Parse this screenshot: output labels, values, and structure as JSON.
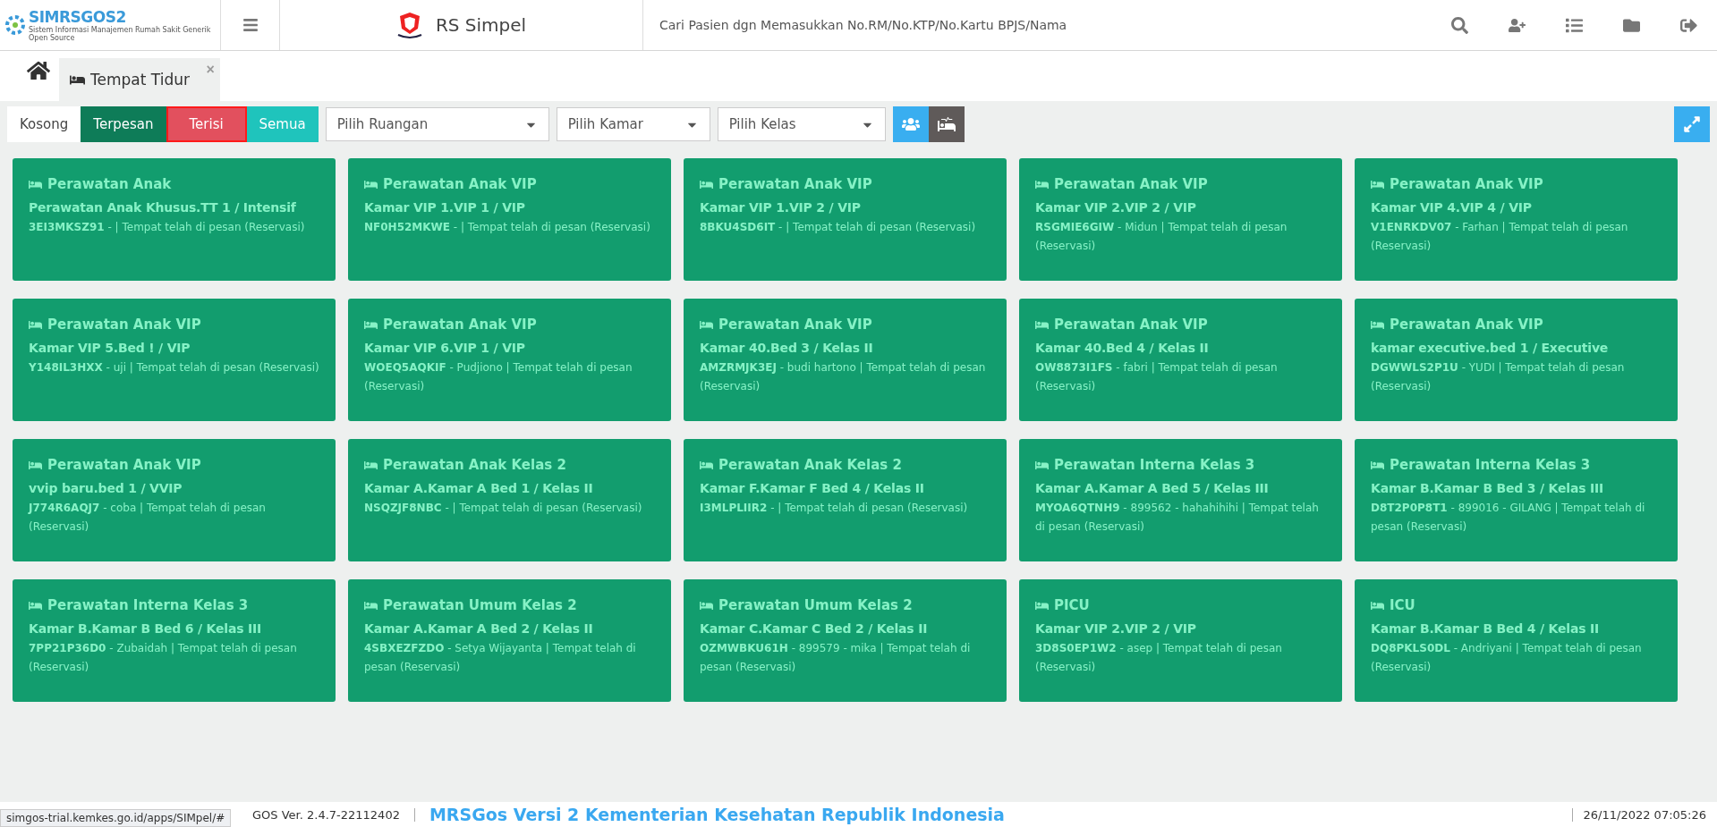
{
  "header": {
    "logo_text": "SIMRSGOS2",
    "logo_subtitle": "Sistem Informasi Manajemen Rumah Sakit Generik Open Source",
    "hospital": "RS Simpel",
    "search_placeholder": "Cari Pasien dgn Memasukkan No.RM/No.KTP/No.Kartu BPJS/Nama"
  },
  "tabs": [
    {
      "label": "Tempat Tidur",
      "selected": true,
      "close": "×"
    }
  ],
  "filters": [
    {
      "label": "Kosong",
      "color": "#ffffff",
      "selected": false
    },
    {
      "label": "Terpesan",
      "color": "#0e7c58",
      "selected": false
    },
    {
      "label": "Terisi",
      "color": "#e2505e",
      "selected": true
    },
    {
      "label": "Semua",
      "color": "#1fc4bc",
      "selected": false
    }
  ],
  "selects": [
    {
      "placeholder": "Pilih Ruangan"
    },
    {
      "placeholder": "Pilih Kamar"
    },
    {
      "placeholder": "Pilih Kelas"
    }
  ],
  "beds": [
    {
      "unit": "Perawatan Anak",
      "room": "Perawatan Anak Khusus.TT 1 / Intensif",
      "detail": "**3EI3MKSZ91** - | Tempat telah di pesan (Reservasi)"
    },
    {
      "unit": "Perawatan Anak VIP",
      "room": "Kamar VIP 1.VIP 1 / VIP",
      "detail": "**NF0H52MKWE** - | Tempat telah di pesan (Reservasi)"
    },
    {
      "unit": "Perawatan Anak VIP",
      "room": "Kamar VIP 1.VIP 2 / VIP",
      "detail": "**8BKU4SD6IT** - | Tempat telah di pesan (Reservasi)"
    },
    {
      "unit": "Perawatan Anak VIP",
      "room": "Kamar VIP 2.VIP 2 / VIP",
      "detail": "**RSGMIE6GIW** - Midun | Tempat telah di pesan (Reservasi)"
    },
    {
      "unit": "Perawatan Anak VIP",
      "room": "Kamar VIP 4.VIP 4 / VIP",
      "detail": "**V1ENRKDV07** - Farhan | Tempat telah di pesan (Reservasi)"
    },
    {
      "unit": "Perawatan Anak VIP",
      "room": "Kamar VIP 5.Bed ! / VIP",
      "detail": "**Y148IL3HXX** - uji | Tempat telah di pesan (Reservasi)"
    },
    {
      "unit": "Perawatan Anak VIP",
      "room": "Kamar VIP 6.VIP 1 / VIP",
      "detail": "**WOEQ5AQKIF** - Pudjiono | Tempat telah di pesan (Reservasi)"
    },
    {
      "unit": "Perawatan Anak VIP",
      "room": "Kamar 40.Bed 3 / Kelas II",
      "detail": "**AMZRMJK3EJ** - budi hartono | Tempat telah di pesan (Reservasi)"
    },
    {
      "unit": "Perawatan Anak VIP",
      "room": "Kamar 40.Bed 4 / Kelas II",
      "detail": "**OW8873I1FS** - fabri | Tempat telah di pesan (Reservasi)"
    },
    {
      "unit": "Perawatan Anak VIP",
      "room": "kamar executive.bed 1 / Executive",
      "detail": "**DGWWLS2P1U** - YUDI | Tempat telah di pesan (Reservasi)"
    },
    {
      "unit": "Perawatan Anak VIP",
      "room": "vvip baru.bed 1 / VVIP",
      "detail": "**J774R6AQJ7** - coba | Tempat telah di pesan (Reservasi)"
    },
    {
      "unit": "Perawatan Anak Kelas 2",
      "room": "Kamar A.Kamar A Bed 1 / Kelas II",
      "detail": "**NSQZJF8NBC** - | Tempat telah di pesan (Reservasi)"
    },
    {
      "unit": "Perawatan Anak Kelas 2",
      "room": "Kamar F.Kamar F Bed 4 / Kelas II",
      "detail": "**I3MLPLIIR2** - | Tempat telah di pesan (Reservasi)"
    },
    {
      "unit": "Perawatan Interna Kelas 3",
      "room": "Kamar A.Kamar A Bed 5 / Kelas III",
      "detail": "**MYOA6QTNH9** - 899562 - hahahihihi | Tempat telah di pesan (Reservasi)"
    },
    {
      "unit": "Perawatan Interna Kelas 3",
      "room": "Kamar B.Kamar B Bed 3 / Kelas III",
      "detail": "**D8T2P0P8T1** - 899016 - GILANG | Tempat telah di pesan (Reservasi)"
    },
    {
      "unit": "Perawatan Interna Kelas 3",
      "room": "Kamar B.Kamar B Bed 6 / Kelas III",
      "detail": "**7PP21P36D0** - Zubaidah | Tempat telah di pesan (Reservasi)"
    },
    {
      "unit": "Perawatan Umum Kelas 2",
      "room": "Kamar A.Kamar A Bed 2 / Kelas II",
      "detail": "**4SBXEZFZDO** - Setya Wijayanta | Tempat telah di pesan (Reservasi)"
    },
    {
      "unit": "Perawatan Umum Kelas 2",
      "room": "Kamar C.Kamar C Bed 2 / Kelas II",
      "detail": "**OZMWBKU61H** - 899579 - mika | Tempat telah di pesan (Reservasi)"
    },
    {
      "unit": "PICU",
      "room": "Kamar VIP 2.VIP 2 / VIP",
      "detail": "**3D8S0EP1W2** - asep | Tempat telah di pesan (Reservasi)"
    },
    {
      "unit": "ICU",
      "room": "Kamar B.Kamar B Bed 4 / Kelas II",
      "detail": "**DQ8PKLS0DL** - Andriyani | Tempat telah di pesan (Reservasi)"
    }
  ],
  "footer": {
    "status_url": "simgos-trial.kemkes.go.id/apps/SIMpel/#",
    "version": "GOS Ver. 2.4.7-22112402",
    "marquee": "MRSGos Versi 2 Kementerian Kesehatan Republik Indonesia",
    "datetime": "26/11/2022 07:05:26"
  }
}
